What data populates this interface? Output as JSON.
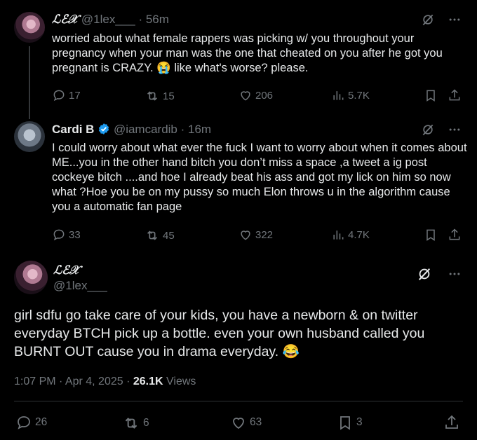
{
  "tweet1": {
    "name": "ℒℰ𝒳",
    "handle": "@1lex___",
    "time": "· 56m",
    "text": "worried about what female rappers was picking w/ you throughout your pregnancy when your man was the one that cheated on you after he got you pregnant is CRAZY. 😭 like what's worse? please.",
    "replies": "17",
    "reposts": "15",
    "likes": "206",
    "views": "5.7K"
  },
  "tweet2": {
    "name": "Cardi B",
    "handle": "@iamcardib",
    "time": "· 16m",
    "text": "I could worry about what ever the fuck I want to worry about when it comes about ME...you in the other hand bitch you don’t miss a space ,a tweet a ig post cockeye bitch ....and hoe I already beat his ass  and got my lick on him so now what ?Hoe you be on my pussy so much Elon throws u in the algorithm cause you a automatic fan page",
    "replies": "33",
    "reposts": "45",
    "likes": "322",
    "views": "4.7K"
  },
  "tweet3": {
    "name": "ℒℰ𝒳",
    "handle": "@1lex___",
    "text": "girl sdfu go take care of your kids, you have a newborn & on twitter everyday BTCH pick up a bottle. even your own husband called you BURNT OUT cause you in drama everyday. 😂",
    "timestamp": "1:07 PM · Apr 4, 2025 ·",
    "views_count": "26.1K",
    "views_label": "Views",
    "replies": "26",
    "reposts": "6",
    "likes": "63",
    "bookmarks": "3"
  },
  "colors": {
    "background": "#000000",
    "text": "#e7e9ea",
    "muted": "#71767b",
    "verified": "#1d9bf0"
  },
  "icons": [
    "reply-icon",
    "repost-icon",
    "like-icon",
    "views-icon",
    "bookmark-icon",
    "share-icon",
    "grok-icon",
    "more-icon",
    "verified-badge-icon"
  ]
}
